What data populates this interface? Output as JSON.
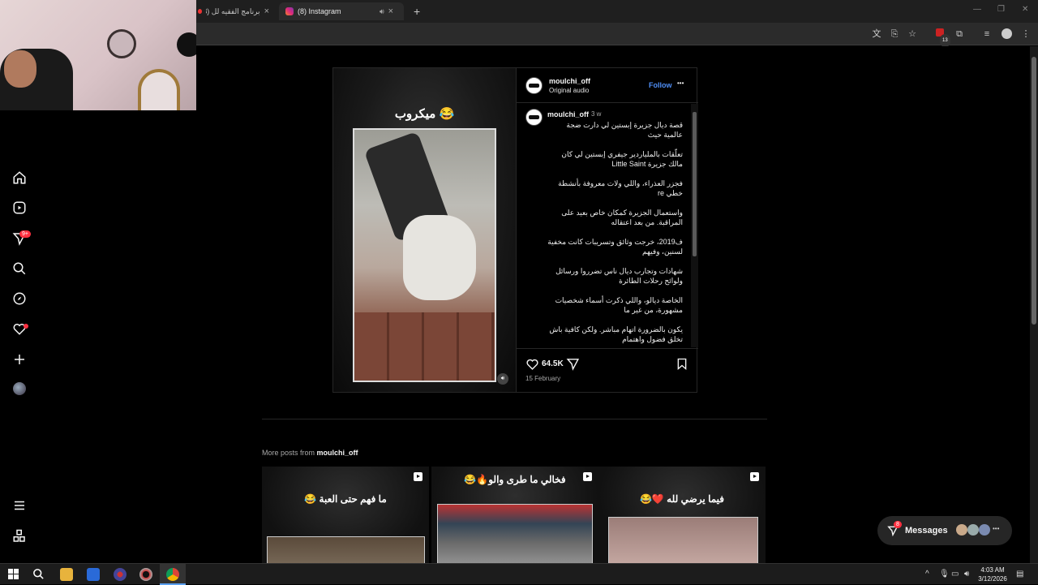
{
  "browser": {
    "tabs": [
      {
        "label": "برنامج الفقيه لل (98)",
        "active": false
      },
      {
        "label": "(8) Instagram",
        "active": true
      }
    ],
    "new_tab": "+",
    "toolbar_icons": [
      "translate-icon",
      "cast-icon",
      "star-icon",
      "extension-badge-icon",
      "puzzle-icon",
      "media-icon",
      "profile-icon",
      "menu-icon"
    ],
    "extension_badge": "13"
  },
  "sidebar": {
    "items": [
      "home-icon",
      "reels-icon",
      "messages-icon",
      "search-icon",
      "explore-icon",
      "notifications-icon",
      "create-icon",
      "profile-icon"
    ],
    "messages_badge": "9+",
    "bottom": [
      "more-icon",
      "apps-icon"
    ]
  },
  "post": {
    "media_title": "ميكروب 😂",
    "author": "moulchi_off",
    "audio": "Original audio",
    "follow": "Follow",
    "more": "•••",
    "caption_author": "moulchi_off",
    "caption_time": "3 w",
    "caption_lines": [
      "قصة ديال جزيرة إبستين لي دارت ضجة عالمية حيث",
      "تعلّقات بالملياردير جيفري إبستين لي كان مالك جزيرة Little Saint",
      "فجزر العذراء، واللي ولات معروفة بأنشطة خطي re",
      "واستعمال الجزيرة كمكان خاص بعيد على المراقبة. من بعد اعتقاله",
      "ف2019، خرجت وثائق وتسريبات كانت مخفية لسنين، وفيهم",
      "شهادات وتجارب ديال ناس تضرروا ورسائل ولوائح رحلات الطائرة",
      "الخاصة ديالو، واللي ذكرت أسماء شخصيات مشهورة، من غير ما",
      "يكون بالضرورة اتهام مباشر. ولكن كافية باش تخلق فضول واهتمام"
    ],
    "likes": "64.5K",
    "date": "15 February"
  },
  "more_posts": {
    "label_prefix": "More posts from",
    "label_user": "moulchi_off",
    "thumbs": [
      {
        "title": "ما فهم حتى العبة 😂"
      },
      {
        "title": "فخالي ما طرى والو🔥😂"
      },
      {
        "title": "فيما يرضي لله ❤️😂"
      }
    ]
  },
  "messages": {
    "label": "Messages",
    "badge": "8"
  },
  "taskbar": {
    "time": "4:03 AM",
    "date": "3/12/2026"
  }
}
